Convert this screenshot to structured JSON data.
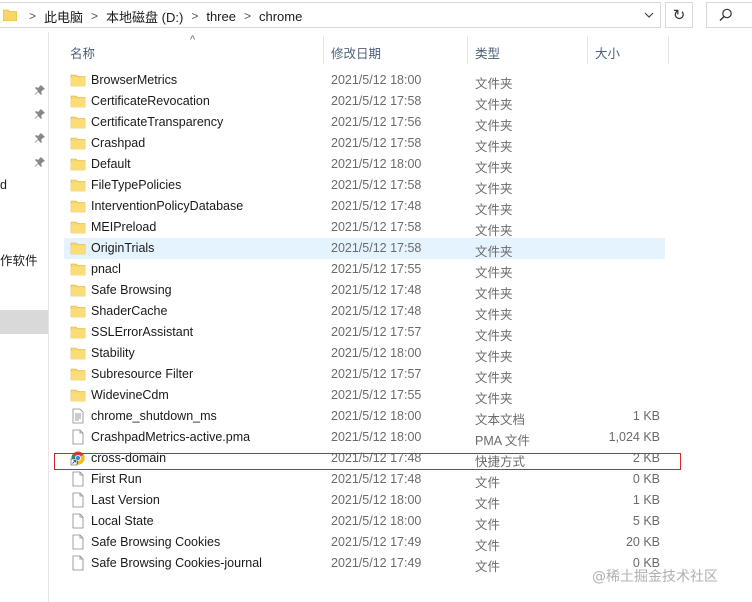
{
  "address_bar": {
    "breadcrumbs": [
      "此电脑",
      "本地磁盘 (D:)",
      "three",
      "chrome"
    ],
    "separator": ">",
    "dropdown_icon": "chevron-down-icon",
    "refresh_icon": "refresh-icon",
    "refresh_glyph": "↻",
    "search_icon": "search-icon"
  },
  "nav_pane": {
    "partial_labels": [
      "d",
      "作软件"
    ]
  },
  "columns": {
    "name": "名称",
    "date": "修改日期",
    "type": "类型",
    "size": "大小",
    "sort_indicator": "^"
  },
  "files": [
    {
      "name": "BrowserMetrics",
      "date": "2021/5/12 18:00",
      "type": "文件夹",
      "size": "",
      "icon": "folder-icon"
    },
    {
      "name": "CertificateRevocation",
      "date": "2021/5/12 17:58",
      "type": "文件夹",
      "size": "",
      "icon": "folder-icon"
    },
    {
      "name": "CertificateTransparency",
      "date": "2021/5/12 17:56",
      "type": "文件夹",
      "size": "",
      "icon": "folder-icon"
    },
    {
      "name": "Crashpad",
      "date": "2021/5/12 17:58",
      "type": "文件夹",
      "size": "",
      "icon": "folder-icon"
    },
    {
      "name": "Default",
      "date": "2021/5/12 18:00",
      "type": "文件夹",
      "size": "",
      "icon": "folder-icon"
    },
    {
      "name": "FileTypePolicies",
      "date": "2021/5/12 17:58",
      "type": "文件夹",
      "size": "",
      "icon": "folder-icon"
    },
    {
      "name": "InterventionPolicyDatabase",
      "date": "2021/5/12 17:48",
      "type": "文件夹",
      "size": "",
      "icon": "folder-icon"
    },
    {
      "name": "MEIPreload",
      "date": "2021/5/12 17:58",
      "type": "文件夹",
      "size": "",
      "icon": "folder-icon"
    },
    {
      "name": "OriginTrials",
      "date": "2021/5/12 17:58",
      "type": "文件夹",
      "size": "",
      "icon": "folder-icon",
      "hover": true
    },
    {
      "name": "pnacl",
      "date": "2021/5/12 17:55",
      "type": "文件夹",
      "size": "",
      "icon": "folder-icon"
    },
    {
      "name": "Safe Browsing",
      "date": "2021/5/12 17:48",
      "type": "文件夹",
      "size": "",
      "icon": "folder-icon"
    },
    {
      "name": "ShaderCache",
      "date": "2021/5/12 17:48",
      "type": "文件夹",
      "size": "",
      "icon": "folder-icon"
    },
    {
      "name": "SSLErrorAssistant",
      "date": "2021/5/12 17:57",
      "type": "文件夹",
      "size": "",
      "icon": "folder-icon"
    },
    {
      "name": "Stability",
      "date": "2021/5/12 18:00",
      "type": "文件夹",
      "size": "",
      "icon": "folder-icon"
    },
    {
      "name": "Subresource Filter",
      "date": "2021/5/12 17:57",
      "type": "文件夹",
      "size": "",
      "icon": "folder-icon"
    },
    {
      "name": "WidevineCdm",
      "date": "2021/5/12 17:55",
      "type": "文件夹",
      "size": "",
      "icon": "folder-icon"
    },
    {
      "name": "chrome_shutdown_ms",
      "date": "2021/5/12 18:00",
      "type": "文本文档",
      "size": "1 KB",
      "icon": "text-file-icon"
    },
    {
      "name": "CrashpadMetrics-active.pma",
      "date": "2021/5/12 18:00",
      "type": "PMA 文件",
      "size": "1,024 KB",
      "icon": "file-icon"
    },
    {
      "name": "cross-domain",
      "date": "2021/5/12 17:48",
      "type": "快捷方式",
      "size": "2 KB",
      "icon": "chrome-shortcut-icon",
      "highlighted": true
    },
    {
      "name": "First Run",
      "date": "2021/5/12 17:48",
      "type": "文件",
      "size": "0 KB",
      "icon": "file-icon"
    },
    {
      "name": "Last Version",
      "date": "2021/5/12 18:00",
      "type": "文件",
      "size": "1 KB",
      "icon": "file-icon"
    },
    {
      "name": "Local State",
      "date": "2021/5/12 18:00",
      "type": "文件",
      "size": "5 KB",
      "icon": "file-icon"
    },
    {
      "name": "Safe Browsing Cookies",
      "date": "2021/5/12 17:49",
      "type": "文件",
      "size": "20 KB",
      "icon": "file-icon"
    },
    {
      "name": "Safe Browsing Cookies-journal",
      "date": "2021/5/12 17:49",
      "type": "文件",
      "size": "0 KB",
      "icon": "file-icon"
    }
  ],
  "colors": {
    "hover_row": "#e5f3ff",
    "highlight_border": "#d0262e",
    "folder": "#f8d568",
    "header_text": "#4c607a"
  },
  "watermark": "@稀土掘金技术社区"
}
